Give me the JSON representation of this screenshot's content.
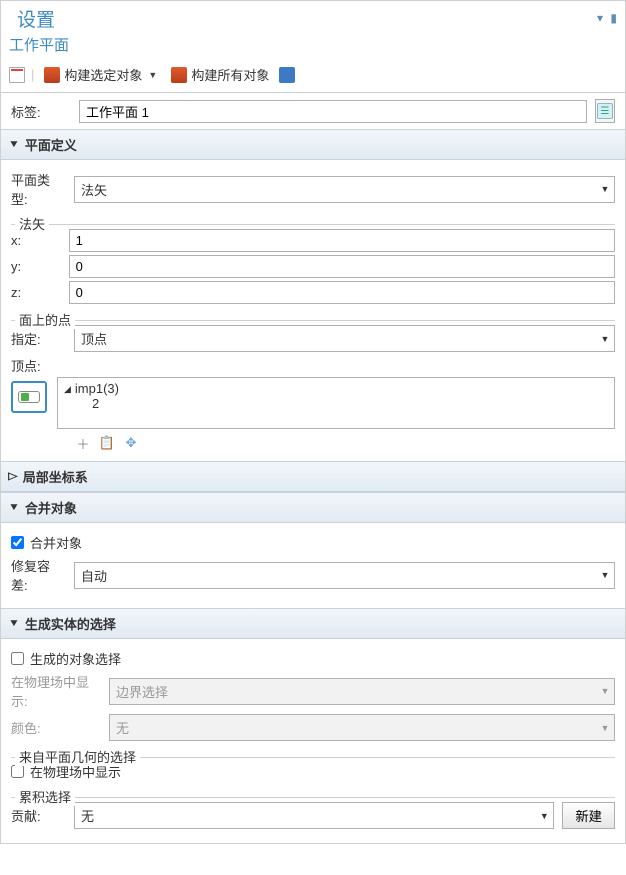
{
  "header": {
    "title": "设置",
    "subtitle": "工作平面"
  },
  "toolbar": {
    "build_selected": "构建选定对象",
    "build_all": "构建所有对象"
  },
  "label_field": {
    "label": "标签:",
    "value": "工作平面 1"
  },
  "sections": {
    "plane_def": {
      "title": "平面定义"
    },
    "local_cs": {
      "title": "局部坐标系"
    },
    "merge": {
      "title": "合并对象"
    },
    "gen_sel": {
      "title": "生成实体的选择"
    }
  },
  "plane": {
    "type_label": "平面类型:",
    "type_value": "法矢",
    "normal_group": "法矢",
    "x_label": "x:",
    "x_value": "1",
    "y_label": "y:",
    "y_value": "0",
    "z_label": "z:",
    "z_value": "0",
    "point_group": "面上的点",
    "specify_label": "指定:",
    "specify_value": "顶点",
    "vertex_label": "顶点:",
    "tree_root": "imp1(3)",
    "tree_child": "2"
  },
  "merge": {
    "checkbox": "合并对象",
    "repair_label": "修复容差:",
    "repair_value": "自动"
  },
  "gensel": {
    "obj_checkbox": "生成的对象选择",
    "show_label": "在物理场中显示:",
    "show_value": "边界选择",
    "color_label": "颜色:",
    "color_value": "无",
    "plane_group": "来自平面几何的选择",
    "phys_checkbox": "在物理场中显示",
    "cum_group": "累积选择",
    "contrib_label": "贡献:",
    "contrib_value": "无",
    "new_btn": "新建"
  }
}
